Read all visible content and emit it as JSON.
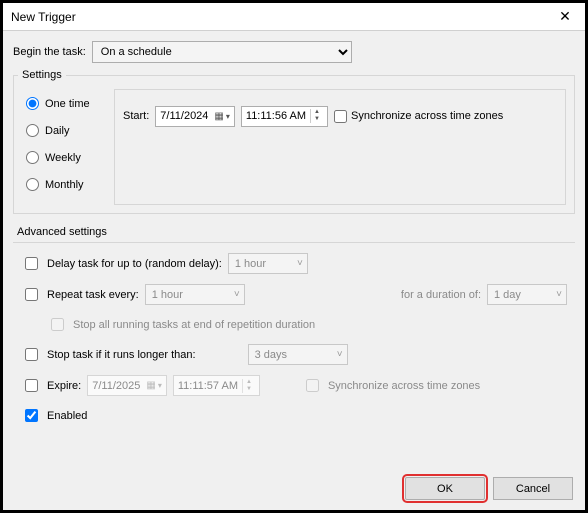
{
  "window": {
    "title": "New Trigger"
  },
  "begin": {
    "label": "Begin the task:",
    "value": "On a schedule"
  },
  "settings": {
    "legend": "Settings",
    "schedule": {
      "onetime": "One time",
      "daily": "Daily",
      "weekly": "Weekly",
      "monthly": "Monthly",
      "selected": "onetime"
    },
    "start_label": "Start:",
    "start_date": "7/11/2024",
    "start_time": "11:11:56 AM",
    "sync_label": "Synchronize across time zones"
  },
  "advanced": {
    "legend": "Advanced settings",
    "delay_label": "Delay task for up to (random delay):",
    "delay_value": "1 hour",
    "repeat_label": "Repeat task every:",
    "repeat_value": "1 hour",
    "duration_label": "for a duration of:",
    "duration_value": "1 day",
    "stop_end_label": "Stop all running tasks at end of repetition duration",
    "stop_longer_label": "Stop task if it runs longer than:",
    "stop_longer_value": "3 days",
    "expire_label": "Expire:",
    "expire_date": "7/11/2025",
    "expire_time": "11:11:57 AM",
    "expire_sync_label": "Synchronize across time zones",
    "enabled_label": "Enabled"
  },
  "buttons": {
    "ok": "OK",
    "cancel": "Cancel"
  }
}
